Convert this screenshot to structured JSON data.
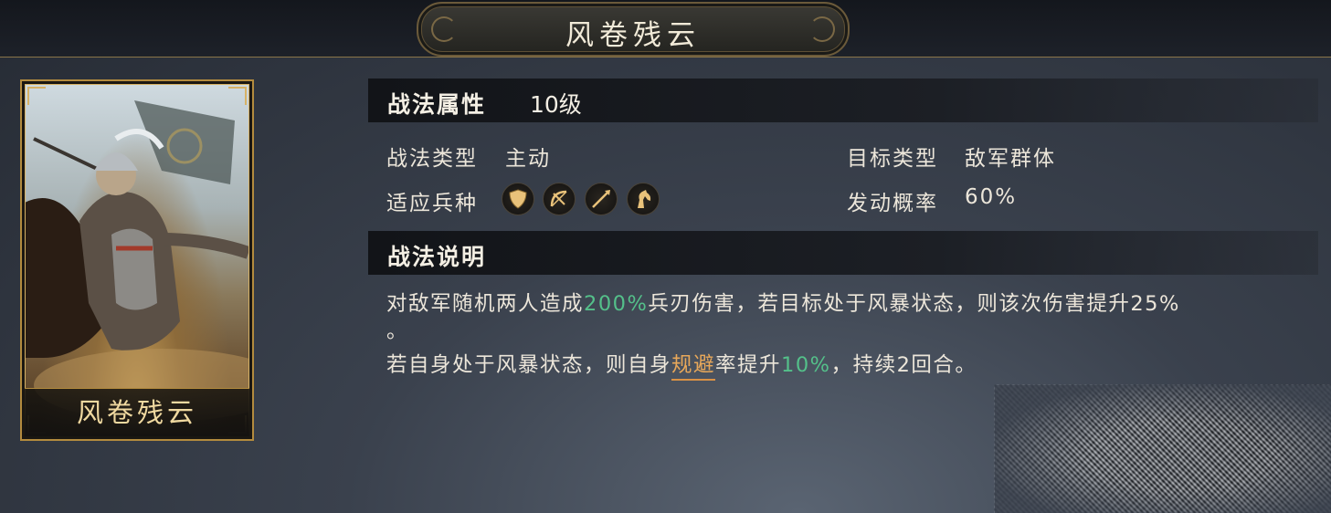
{
  "header": {
    "title": "风卷残云"
  },
  "card": {
    "caption": "风卷残云"
  },
  "attributes": {
    "section_title": "战法属性",
    "level": "10级",
    "tactic_type_label": "战法类型",
    "tactic_type_value": "主动",
    "target_type_label": "目标类型",
    "target_type_value": "敌军群体",
    "troop_label": "适应兵种",
    "troop_icons": [
      "shield-icon",
      "bow-icon",
      "spear-icon",
      "horse-icon"
    ],
    "trigger_rate_label": "发动概率",
    "trigger_rate_value": "60%"
  },
  "description": {
    "section_title": "战法说明",
    "line1_a": "对敌军随机两人造成",
    "line1_b": "200%",
    "line1_c": "兵刃伤害，若目标处于风暴状态，则该次伤害提升25%",
    "line2": "。",
    "line3_a": "若自身处于风暴状态，则自身",
    "line3_b": "规避",
    "line3_c": "率提升",
    "line3_d": "10%",
    "line3_e": "，持续2回合。"
  },
  "colors": {
    "highlight_green": "#54c08a",
    "highlight_orange": "#e8a85a",
    "gold_frame": "#b38b3e"
  }
}
